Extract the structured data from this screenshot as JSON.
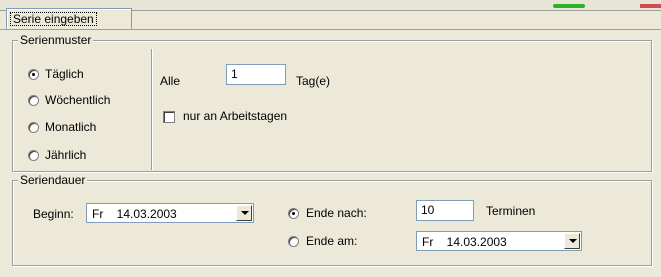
{
  "tab": {
    "label": "Serie eingeben"
  },
  "serienmuster": {
    "legend": "Serienmuster",
    "options": [
      {
        "label": "Täglich",
        "selected": true
      },
      {
        "label": "Wöchentlich",
        "selected": false
      },
      {
        "label": "Monatlich",
        "selected": false
      },
      {
        "label": "Jährlich",
        "selected": false
      }
    ],
    "alle_label": "Alle",
    "alle_value": "1",
    "unit_label": "Tag(e)",
    "workdays_checkbox": {
      "label": "nur an Arbeitstagen",
      "checked": false
    }
  },
  "seriendauer": {
    "legend": "Seriendauer",
    "beginn_label": "Beginn:",
    "beginn_value": "Fr    14.03.2003",
    "end_options": [
      {
        "label": "Ende nach:",
        "selected": true
      },
      {
        "label": "Ende am:",
        "selected": false
      }
    ],
    "ende_nach_value": "10",
    "termine_label": "Terminen",
    "ende_am_value": "Fr    14.03.2003"
  },
  "colors": {
    "window_bg": "#ece9d8",
    "field_border": "#7f9db9",
    "groupbox_border": "#9d9d9d"
  }
}
